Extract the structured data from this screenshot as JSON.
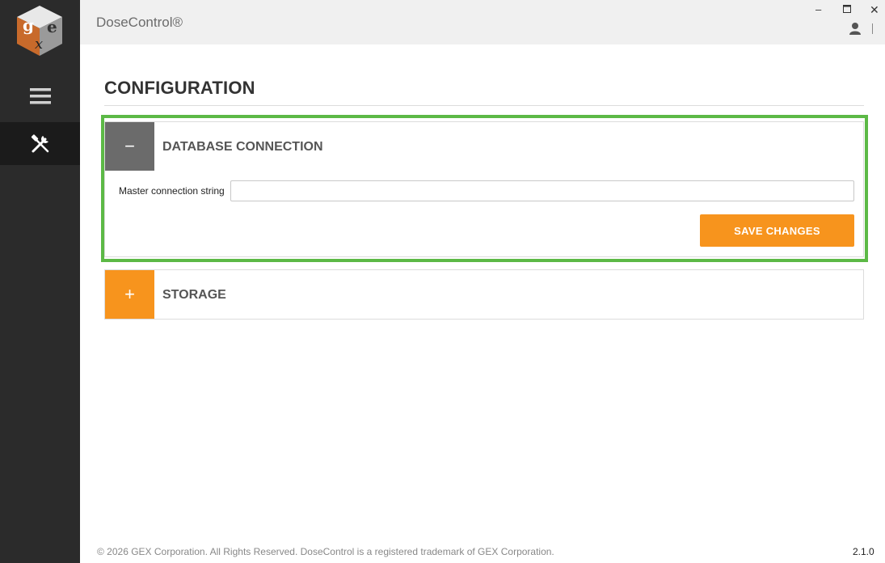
{
  "app": {
    "title": "DoseControl®"
  },
  "window_controls": {
    "minimize": "–",
    "maximize": "▫",
    "close": "✕"
  },
  "sidebar": {
    "logo_icon": "gex-cube-logo-icon",
    "items": [
      {
        "icon": "hamburger-menu-icon"
      },
      {
        "icon": "tools-icon",
        "active": true
      }
    ]
  },
  "page": {
    "title": "CONFIGURATION"
  },
  "panels": {
    "database": {
      "toggle": "−",
      "heading": "DATABASE CONNECTION",
      "expanded": true,
      "field_label": "Master connection string",
      "field_value": "",
      "save_label": "SAVE CHANGES"
    },
    "storage": {
      "toggle": "+",
      "heading": "STORAGE",
      "expanded": false
    }
  },
  "colors": {
    "accent": "#f7941d",
    "highlight": "#5cb946",
    "sidebar": "#2b2b2b",
    "collapse_toggle": "#6b6b6b"
  },
  "footer": {
    "copyright": "© 2026 GEX Corporation. All Rights Reserved. DoseControl is a registered trademark of GEX Corporation.",
    "version": "2.1.0"
  }
}
